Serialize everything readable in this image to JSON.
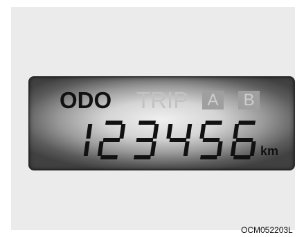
{
  "display": {
    "mode_odo": "ODO",
    "mode_trip": "TRIP",
    "trip_a": "A",
    "trip_b": "B",
    "reading": "123456",
    "unit": "km"
  },
  "caption": "OCM052203L",
  "colors": {
    "segment_on": "#111111",
    "indicator_off": "#c2c2c2",
    "box_off": "#9f9f9f"
  }
}
